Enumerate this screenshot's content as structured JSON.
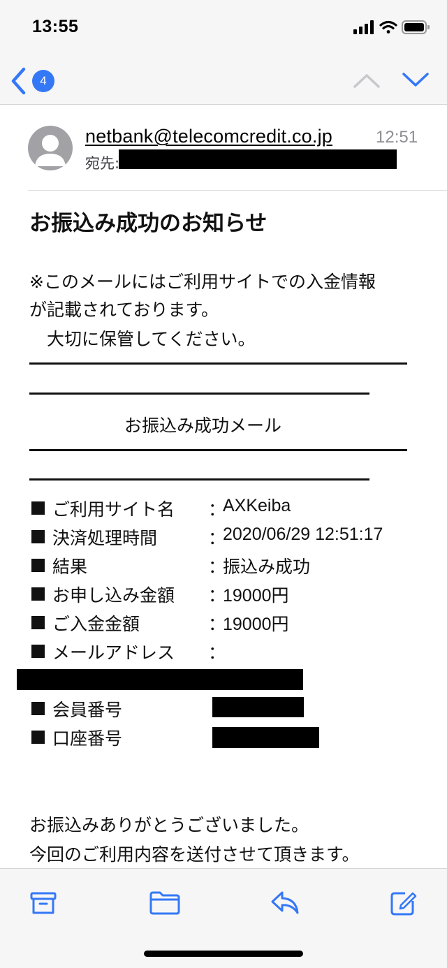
{
  "status_bar": {
    "time": "13:55",
    "icons": [
      "cellular-signal-icon",
      "wifi-icon",
      "battery-icon"
    ]
  },
  "nav": {
    "unread_count": "4",
    "accent": "#3478f6"
  },
  "header": {
    "sender": "netbank@telecomcredit.co.jp",
    "time": "12:51",
    "to_label": "宛先:"
  },
  "mail": {
    "subject": "お振込み成功のお知らせ",
    "intro_lines": [
      "※このメールにはご利用サイトでの入金情報",
      "が記載されております。",
      "　大切に保管してください。"
    ],
    "banner_title": "お振込み成功メール",
    "details": [
      {
        "label": "ご利用サイト名",
        "value": "AXKeiba"
      },
      {
        "label": "決済処理時間",
        "value": "2020/06/29 12:51:17"
      },
      {
        "label": "結果",
        "value": "振込み成功"
      },
      {
        "label": "お申し込み金額",
        "value": "19000円"
      },
      {
        "label": "ご入金金額",
        "value": "19000円"
      },
      {
        "label": "メールアドレス",
        "value": ""
      },
      {
        "label": "会員番号",
        "value": ""
      },
      {
        "label": "口座番号",
        "value": ""
      }
    ],
    "closing_lines": [
      "お振込みありがとうございました。",
      "今回のご利用内容を送付させて頂きます。"
    ]
  },
  "toolbar": {
    "icons": [
      "archive-icon",
      "folder-icon",
      "reply-icon",
      "compose-icon"
    ]
  }
}
